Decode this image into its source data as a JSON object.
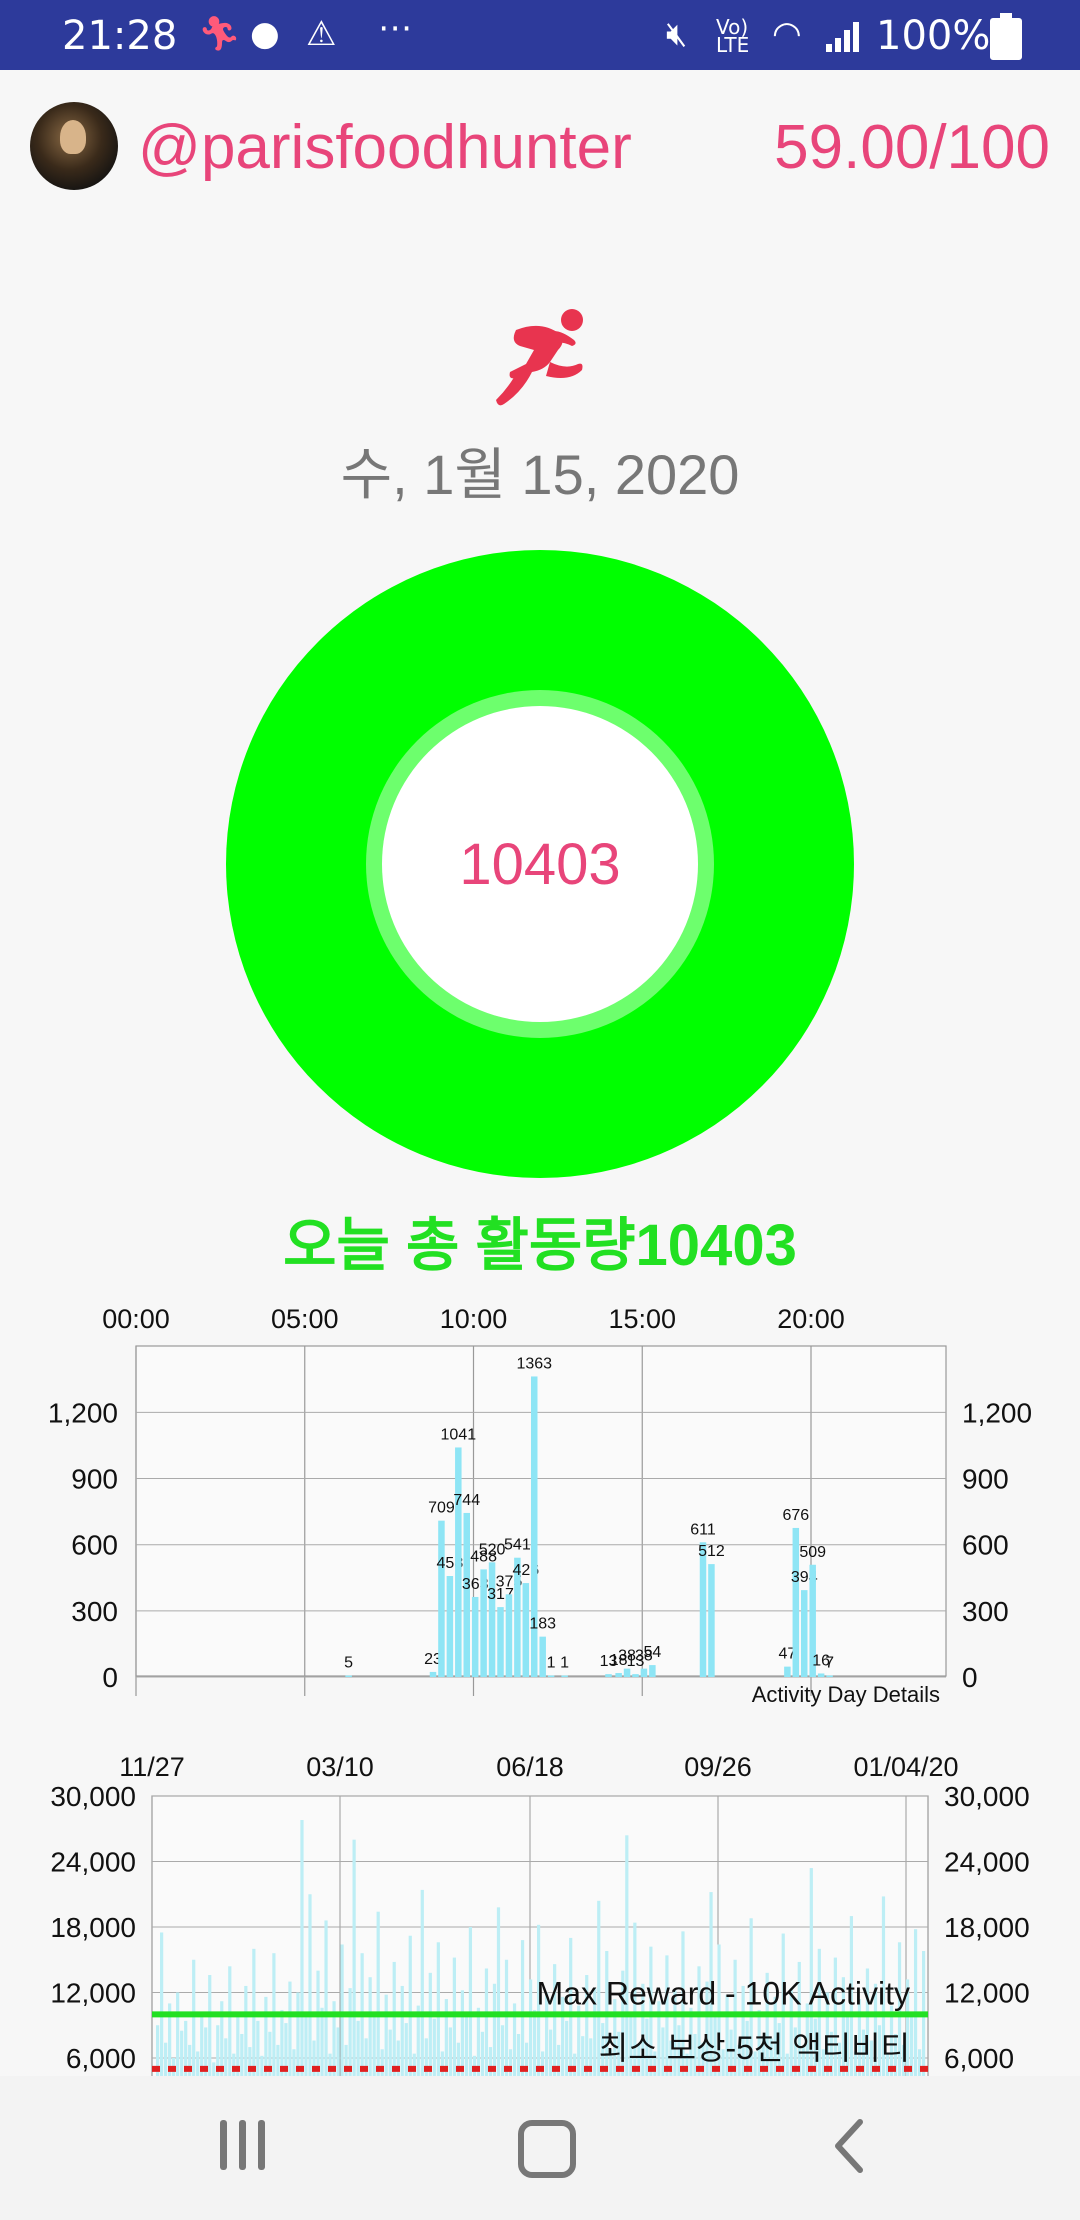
{
  "status_bar": {
    "time": "21:28",
    "battery": "100%",
    "icons": [
      "runner-icon",
      "chat-icon",
      "alert-icon",
      "more-dots-icon",
      "mute-icon",
      "volte-icon",
      "wifi-icon",
      "signal-icon",
      "battery-icon"
    ]
  },
  "header": {
    "handle": "@parisfoodhunter",
    "score": "59.00/100"
  },
  "date": "수, 1월 15, 2020",
  "donut": {
    "center_value": "10403",
    "colors": {
      "ring": "#00ff00",
      "inner_ring": "#6dff6d",
      "value_text": "#e8457a"
    }
  },
  "total_label": "오늘 총 활동량10403",
  "chart_data": [
    {
      "type": "bar",
      "x_tick_labels": [
        "00:00",
        "05:00",
        "10:00",
        "15:00",
        "20:00"
      ],
      "x_range": [
        0,
        24
      ],
      "ylim": [
        0,
        1500
      ],
      "y_ticks": [
        0,
        300,
        600,
        900,
        "1,200"
      ],
      "corner_label": "Activity Day Details",
      "grid": true,
      "bar_color": "#8ee5f5",
      "points": [
        {
          "t": 6.3,
          "v": 5,
          "label": "5"
        },
        {
          "t": 8.8,
          "v": 23,
          "label": "23"
        },
        {
          "t": 9.05,
          "v": 709,
          "label": "709"
        },
        {
          "t": 9.3,
          "v": 458,
          "label": "458"
        },
        {
          "t": 9.55,
          "v": 1041,
          "label": "1041"
        },
        {
          "t": 9.8,
          "v": 744,
          "label": "744"
        },
        {
          "t": 10.05,
          "v": 363,
          "label": "363"
        },
        {
          "t": 10.3,
          "v": 488,
          "label": "488"
        },
        {
          "t": 10.55,
          "v": 520,
          "label": "520"
        },
        {
          "t": 10.8,
          "v": 317,
          "label": "317"
        },
        {
          "t": 11.05,
          "v": 375,
          "label": "375"
        },
        {
          "t": 11.3,
          "v": 541,
          "label": "541"
        },
        {
          "t": 11.55,
          "v": 426,
          "label": "426"
        },
        {
          "t": 11.8,
          "v": 1363,
          "label": "1363"
        },
        {
          "t": 12.05,
          "v": 183,
          "label": "183"
        },
        {
          "t": 12.3,
          "v": 1,
          "label": "1"
        },
        {
          "t": 12.7,
          "v": 1,
          "label": "1"
        },
        {
          "t": 14.0,
          "v": 13,
          "label": "13"
        },
        {
          "t": 14.3,
          "v": 18,
          "label": "18"
        },
        {
          "t": 14.55,
          "v": 38,
          "label": "38"
        },
        {
          "t": 14.8,
          "v": 13,
          "label": "13"
        },
        {
          "t": 15.05,
          "v": 38,
          "label": "38"
        },
        {
          "t": 15.3,
          "v": 54,
          "label": "54"
        },
        {
          "t": 16.8,
          "v": 611,
          "label": "611"
        },
        {
          "t": 17.05,
          "v": 512,
          "label": "512"
        },
        {
          "t": 19.3,
          "v": 47,
          "label": "47"
        },
        {
          "t": 19.55,
          "v": 676,
          "label": "676"
        },
        {
          "t": 19.8,
          "v": 394,
          "label": "394"
        },
        {
          "t": 20.05,
          "v": 509,
          "label": "509"
        },
        {
          "t": 20.3,
          "v": 16,
          "label": "16"
        },
        {
          "t": 20.55,
          "v": 7,
          "label": "7"
        }
      ]
    },
    {
      "type": "bar",
      "x_tick_labels": [
        "11/27",
        "03/10",
        "06/18",
        "09/26",
        "01/04/20"
      ],
      "ylim": [
        0,
        30000
      ],
      "y_ticks": [
        "6,000",
        "12,000",
        "18,000",
        "24,000",
        "30,000"
      ],
      "bar_color": "#bdeef5",
      "reference_lines": [
        {
          "label": "Max Reward - 10K Activity",
          "value": 10000,
          "color": "#22e022",
          "style": "solid"
        },
        {
          "label": "최소 보상-5천 액티비티",
          "value": 5000,
          "color": "#e02020",
          "style": "dashed"
        }
      ],
      "daily_values": [
        9000,
        17500,
        7400,
        11000,
        6000,
        12000,
        8500,
        9400,
        7200,
        15000,
        6600,
        10200,
        8800,
        13600,
        5600,
        9000,
        11200,
        7800,
        14400,
        6400,
        10000,
        8200,
        12600,
        7000,
        16000,
        9400,
        6200,
        11600,
        8400,
        15600,
        7200,
        10400,
        9200,
        13000,
        6800,
        12000,
        27800,
        9800,
        21000,
        7600,
        14000,
        10600,
        18600,
        6400,
        11200,
        8800,
        16400,
        7200,
        12400,
        26000,
        9400,
        15600,
        7800,
        13400,
        10200,
        19400,
        6800,
        11800,
        8600,
        14800,
        7600,
        12600,
        9200,
        17200,
        6400,
        10800,
        21400,
        7800,
        13800,
        9600,
        16600,
        6600,
        11400,
        8800,
        15200,
        7400,
        12200,
        9800,
        18000,
        6200,
        10600,
        8400,
        14200,
        7000,
        12800,
        19800,
        9000,
        15000,
        6800,
        11000,
        8200,
        16800,
        7400,
        13200,
        10400,
        18200,
        6600,
        12000,
        8600,
        14600,
        7200,
        11600,
        9400,
        17000,
        6400,
        10800,
        8000,
        13600,
        7800,
        12400,
        20400,
        9200,
        15800,
        6800,
        11400,
        8400,
        14000,
        26400,
        10000,
        18400,
        7200,
        12800,
        9600,
        16200,
        6600,
        11200,
        8800,
        15400,
        7600,
        12200,
        9000,
        17600,
        6400,
        10600,
        8200,
        14400,
        7400,
        13000,
        21200,
        9800,
        16400,
        6800,
        11800,
        8600,
        15000,
        7200,
        12600,
        9400,
        18800,
        6600,
        10400,
        8000,
        13800,
        7800,
        11600,
        9200,
        17400,
        6400,
        12400,
        8800,
        14800,
        7000,
        11000,
        23400,
        9600,
        16000,
        6800,
        12000,
        8400,
        15200,
        7400,
        13400,
        10200,
        19000,
        6600,
        11400,
        8600,
        14200,
        7600,
        12800,
        9000,
        20800,
        6400,
        10800,
        8200,
        16600,
        7200,
        13200,
        9800,
        17800,
        6800,
        15800
      ]
    }
  ]
}
